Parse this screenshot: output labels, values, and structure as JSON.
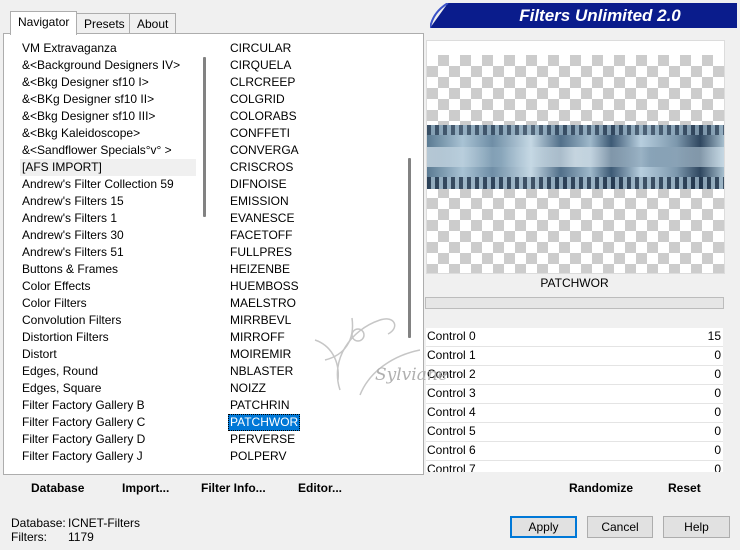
{
  "tabs": [
    "Navigator",
    "Presets",
    "About"
  ],
  "banner_title": "Filters Unlimited 2.0",
  "categories": [
    "VM Extravaganza",
    "&<Background Designers IV>",
    "&<Bkg Designer sf10 I>",
    "&<BKg Designer sf10 II>",
    "&<Bkg Designer sf10 III>",
    "&<Bkg Kaleidoscope>",
    "&<Sandflower Specials°v° >",
    "[AFS IMPORT]",
    "Andrew's Filter Collection 59",
    "Andrew's Filters 15",
    "Andrew's Filters 1",
    "Andrew's Filters 30",
    "Andrew's Filters 51",
    "Buttons & Frames",
    "Color Effects",
    "Color Filters",
    "Convolution Filters",
    "Distortion Filters",
    "Distort",
    "Edges, Round",
    "Edges, Square",
    "Filter Factory Gallery B",
    "Filter Factory Gallery C",
    "Filter Factory Gallery D",
    "Filter Factory Gallery J"
  ],
  "filters": [
    "CIRCULAR",
    "CIRQUELA",
    "CLRCREEP",
    "COLGRID",
    "COLORABS",
    "CONFFETI",
    "CONVERGA",
    "CRISCROS",
    "DIFNOISE",
    "EMISSION",
    "EVANESCE",
    "FACETOFF",
    "FULLPRES",
    "HEIZENBE",
    "HUEMBOSS",
    "MAELSTRO",
    "MIRRBEVL",
    "MIRROFF",
    "MOIREMIR",
    "NBLASTER",
    "NOIZZ",
    "PATCHRIN",
    "PATCHWOR",
    "PERVERSE",
    "POLPERV"
  ],
  "selected_filter_index": 22,
  "highlighted_category_index": 7,
  "selected_filter_name": "PATCHWOR",
  "controls": [
    {
      "label": "Control 0",
      "value": "15"
    },
    {
      "label": "Control 1",
      "value": "0"
    },
    {
      "label": "Control 2",
      "value": "0"
    },
    {
      "label": "Control 3",
      "value": "0"
    },
    {
      "label": "Control 4",
      "value": "0"
    },
    {
      "label": "Control 5",
      "value": "0"
    },
    {
      "label": "Control 6",
      "value": "0"
    },
    {
      "label": "Control 7",
      "value": "0"
    }
  ],
  "toolbar": {
    "database": "Database",
    "import": "Import...",
    "filter_info": "Filter Info...",
    "editor": "Editor...",
    "randomize": "Randomize",
    "reset": "Reset"
  },
  "status": {
    "database_label": "Database:",
    "database_value": "ICNET-Filters",
    "filters_label": "Filters:",
    "filters_value": "1179"
  },
  "buttons": {
    "apply": "Apply",
    "cancel": "Cancel",
    "help": "Help"
  },
  "watermark_text": "Sylviane",
  "colors": {
    "banner_bg": "#0a1c8c",
    "selection": "#0078d7"
  }
}
